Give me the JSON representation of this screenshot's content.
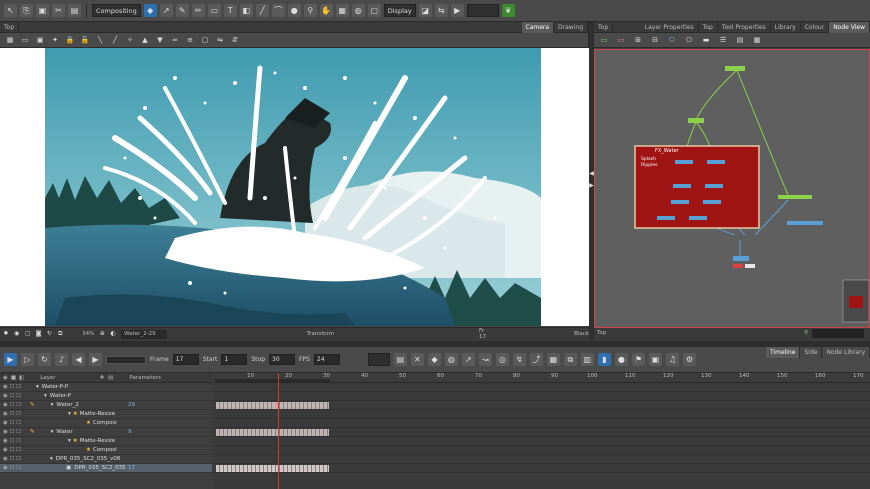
{
  "toolbar": {
    "workspace": "Compositing",
    "display": "Display"
  },
  "left_panel": {
    "view_title": "Top",
    "tabs": [
      "Camera",
      "Drawing"
    ],
    "status": {
      "zoom": "34%",
      "drawing_name": "Water_2-29",
      "mode": "Transform",
      "frame": "Fr 17",
      "palette": "Black"
    }
  },
  "right_panel": {
    "view_title": "Top",
    "tabs": [
      "Layer Properties",
      "Top",
      "Tool Properties",
      "Library",
      "Colour",
      "Node View"
    ],
    "group_title": "FX_Water",
    "group_note": "Splash\nRipples",
    "status": "Top"
  },
  "timeline": {
    "frame_label": "Frame",
    "frame_value": "17",
    "start_label": "Start",
    "start_value": "1",
    "stop_label": "Stop",
    "stop_value": "30",
    "fps_label": "FPS",
    "fps_value": "24",
    "tabs": [
      "Timeline",
      "Side",
      "Node Library"
    ],
    "columns": {
      "layer": "Layer",
      "params": "Parameters"
    },
    "ruler": [
      "10",
      "20",
      "30",
      "40",
      "50",
      "60",
      "70",
      "80",
      "90",
      "100",
      "110",
      "120",
      "130",
      "140",
      "150",
      "160",
      "170"
    ],
    "layers": [
      {
        "name": "Water-P-P",
        "value": ""
      },
      {
        "name": "Water-P",
        "value": ""
      },
      {
        "name": "Water_2",
        "value": "29"
      },
      {
        "name": "Matte-Resize",
        "value": ""
      },
      {
        "name": "Composi",
        "value": ""
      },
      {
        "name": "Water",
        "value": "9"
      },
      {
        "name": "Matte-Resize",
        "value": ""
      },
      {
        "name": "Composi",
        "value": ""
      },
      {
        "name": "DPR_035_SC2_035_v08",
        "value": ""
      },
      {
        "name": "DPR_035_SC2_035",
        "value": "17"
      }
    ]
  },
  "colors": {
    "accent": "#2d6fb0",
    "group_red": "#a01414",
    "playhead": "#e03030"
  }
}
